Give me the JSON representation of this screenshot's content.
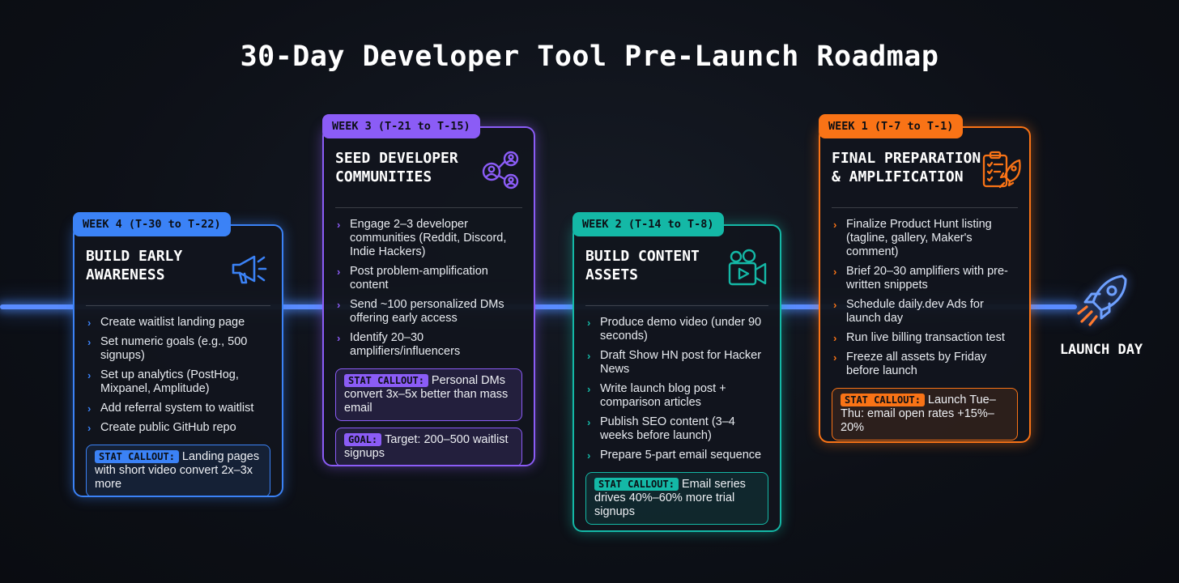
{
  "title": "30-Day Developer Tool Pre-Launch Roadmap",
  "colors": {
    "week4": "#3b82f6",
    "week3": "#8b5cf6",
    "week2": "#14b8a6",
    "week1": "#f97316",
    "timeline": "#5a8cff"
  },
  "cards": {
    "week4": {
      "tag": "WEEK 4 (T-30 to T-22)",
      "title": "BUILD EARLY\nAWARENESS",
      "icon": "megaphone-icon",
      "items": [
        "Create waitlist landing page",
        "Set numeric goals (e.g., 500 signups)",
        "Set up analytics (PostHog, Mixpanel, Amplitude)",
        "Add referral system to waitlist",
        "Create public GitHub repo"
      ],
      "callout_label": "STAT CALLOUT:",
      "callout_text": "Landing pages with short video convert 2x–3x more"
    },
    "week3": {
      "tag": "WEEK 3 (T-21 to T-15)",
      "title": "SEED DEVELOPER\nCOMMUNITIES",
      "icon": "community-icon",
      "items": [
        "Engage 2–3 developer communities (Reddit, Discord, Indie Hackers)",
        "Post problem-amplification content",
        "Send ~100 personalized DMs offering early access",
        "Identify 20–30 amplifiers/influencers"
      ],
      "callout_label": "STAT CALLOUT:",
      "callout_text": "Personal DMs convert 3x–5x better than mass email",
      "goal_label": "GOAL:",
      "goal_text": "Target: 200–500 waitlist signups"
    },
    "week2": {
      "tag": "WEEK 2 (T-14 to T-8)",
      "title": "BUILD CONTENT\nASSETS",
      "icon": "video-camera-icon",
      "items": [
        "Produce demo video (under 90 seconds)",
        "Draft Show HN post for Hacker News",
        "Write launch blog post + comparison articles",
        "Publish SEO content (3–4 weeks before launch)",
        "Prepare 5-part email sequence"
      ],
      "callout_label": "STAT CALLOUT:",
      "callout_text": "Email series drives 40%–60% more trial signups"
    },
    "week1": {
      "tag": "WEEK 1 (T-7 to T-1)",
      "title": "FINAL PREPARATION\n& AMPLIFICATION",
      "icon": "clipboard-rocket-icon",
      "items": [
        "Finalize Product Hunt listing (tagline, gallery, Maker's comment)",
        "Brief 20–30 amplifiers with pre-written snippets",
        "Schedule daily.dev Ads for launch day",
        "Run live billing transaction test",
        "Freeze all assets by Friday before launch"
      ],
      "callout_label": "STAT CALLOUT:",
      "callout_text": "Launch Tue–Thu: email open rates +15%–20%"
    }
  },
  "launch": {
    "label": "LAUNCH DAY",
    "icon": "rocket-icon"
  }
}
